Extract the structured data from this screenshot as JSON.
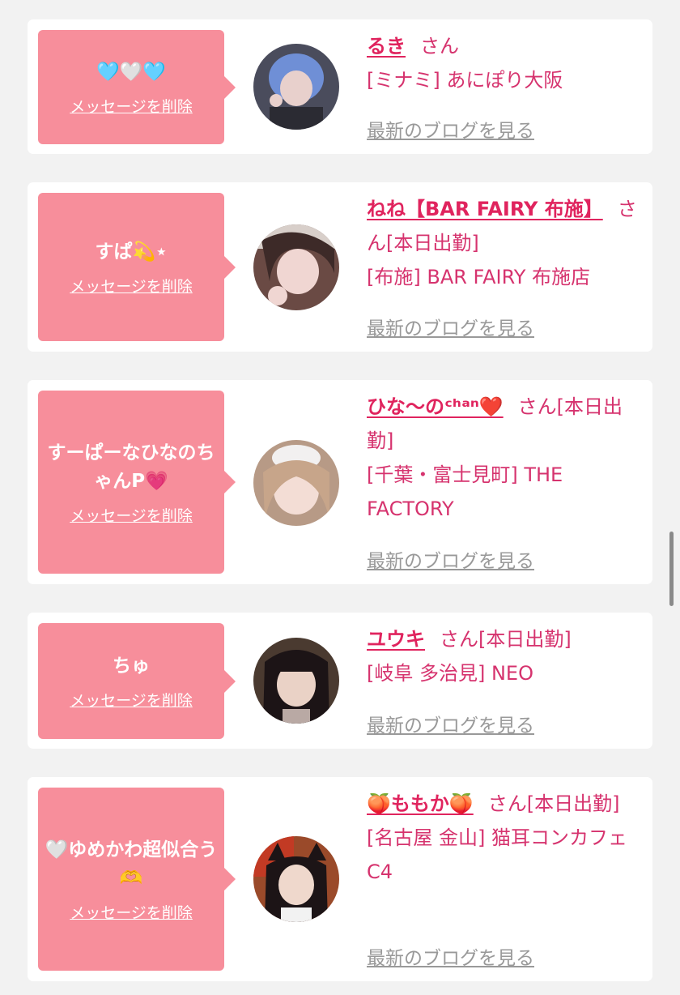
{
  "delete_label": "メッセージを削除",
  "blog_label": "最新のブログを見る",
  "honorific": "さん",
  "cards": [
    {
      "message": "🩵🤍🩵",
      "name": "るき",
      "status": "",
      "shop": "[ミナミ] あにぽり大阪"
    },
    {
      "message": "すぱ💫⋆",
      "name": "ねね【BAR FAIRY 布施】",
      "status": "[本日出勤]",
      "shop": "[布施] BAR FAIRY 布施店"
    },
    {
      "message": "すーぱーなひなのちゃんP💗",
      "name": "ひな〜のᶜʰᵃⁿ❤️",
      "status": "[本日出勤]",
      "shop": "[千葉・富士見町] THE FACTORY"
    },
    {
      "message": "ちゅ",
      "name": "ユウキ",
      "status": "[本日出勤]",
      "shop": "[岐阜 多治見] NEO"
    },
    {
      "message": "🤍ゆめかわ超似合う🫶",
      "name": "🍑ももか🍑",
      "status": "[本日出勤]",
      "shop": "[名古屋 金山] 猫耳コンカフェ C4"
    }
  ],
  "colors": {
    "background": "#f2f2f2",
    "bubble": "#f78e9b",
    "accent": "#e0245e",
    "link_gray": "#999999"
  }
}
